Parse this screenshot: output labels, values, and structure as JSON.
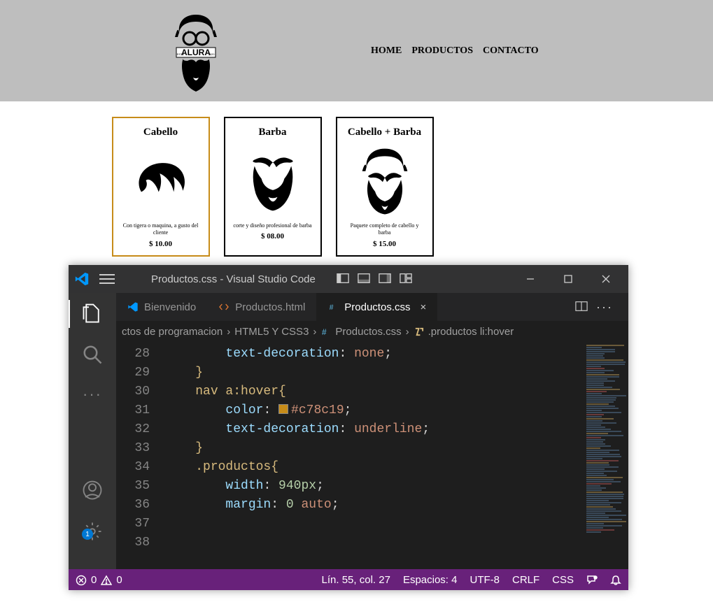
{
  "site": {
    "nav": [
      "HOME",
      "PRODUCTOS",
      "CONTACTO"
    ],
    "products": [
      {
        "title": "Cabello",
        "desc": "Con tigera o maquina, a gusto del cliente",
        "price": "$ 10.00"
      },
      {
        "title": "Barba",
        "desc": "corte y diseño profesional de barba",
        "price": "$ 08.00"
      },
      {
        "title": "Cabello + Barba",
        "desc": "Paquete completo de cabello y barba",
        "price": "$ 15.00"
      }
    ]
  },
  "vscode": {
    "title": "Productos.css - Visual Studio Code",
    "tabs": [
      {
        "label": "Bienvenido",
        "icon": "vscode"
      },
      {
        "label": "Productos.html",
        "icon": "html"
      },
      {
        "label": "Productos.css",
        "icon": "css",
        "active": true,
        "close": true
      }
    ],
    "breadcrumb": {
      "p1": "ctos de programacion",
      "p2": "HTML5 Y CSS3",
      "p3": "Productos.css",
      "p4": ".productos li:hover"
    },
    "gutter_start": 28,
    "lines": [
      {
        "indent": 2,
        "tokens": [
          {
            "t": "prop",
            "s": "text-decoration"
          },
          {
            "t": "punc",
            "s": ": "
          },
          {
            "t": "str",
            "s": "none"
          },
          {
            "t": "punc",
            "s": ";"
          }
        ]
      },
      {
        "indent": 1,
        "tokens": [
          {
            "t": "sel",
            "s": "}"
          }
        ]
      },
      {
        "indent": 0,
        "tokens": []
      },
      {
        "indent": 1,
        "tokens": [
          {
            "t": "sel",
            "s": "nav a:hover"
          },
          {
            "t": "sel",
            "s": "{"
          }
        ]
      },
      {
        "indent": 2,
        "tokens": [
          {
            "t": "prop",
            "s": "color"
          },
          {
            "t": "punc",
            "s": ": "
          },
          {
            "t": "swatch",
            "s": ""
          },
          {
            "t": "str",
            "s": "#c78c19"
          },
          {
            "t": "punc",
            "s": ";"
          }
        ]
      },
      {
        "indent": 2,
        "tokens": [
          {
            "t": "prop",
            "s": "text-decoration"
          },
          {
            "t": "punc",
            "s": ": "
          },
          {
            "t": "str",
            "s": "underline"
          },
          {
            "t": "punc",
            "s": ";"
          }
        ]
      },
      {
        "indent": 1,
        "tokens": [
          {
            "t": "sel",
            "s": "}"
          }
        ]
      },
      {
        "indent": 0,
        "tokens": []
      },
      {
        "indent": 1,
        "tokens": [
          {
            "t": "sel",
            "s": ".productos"
          },
          {
            "t": "sel",
            "s": "{"
          }
        ]
      },
      {
        "indent": 2,
        "tokens": [
          {
            "t": "prop",
            "s": "width"
          },
          {
            "t": "punc",
            "s": ": "
          },
          {
            "t": "num",
            "s": "940px"
          },
          {
            "t": "punc",
            "s": ";"
          }
        ]
      },
      {
        "indent": 2,
        "tokens": [
          {
            "t": "prop",
            "s": "margin"
          },
          {
            "t": "punc",
            "s": ": "
          },
          {
            "t": "num",
            "s": "0"
          },
          {
            "t": "punc",
            "s": " "
          },
          {
            "t": "str",
            "s": "auto"
          },
          {
            "t": "punc",
            "s": ";"
          }
        ]
      }
    ],
    "status": {
      "errors": "0",
      "warnings": "0",
      "position": "Lín. 55, col. 27",
      "spaces": "Espacios: 4",
      "encoding": "UTF-8",
      "eol": "CRLF",
      "lang": "CSS",
      "settings_badge": "1"
    }
  }
}
